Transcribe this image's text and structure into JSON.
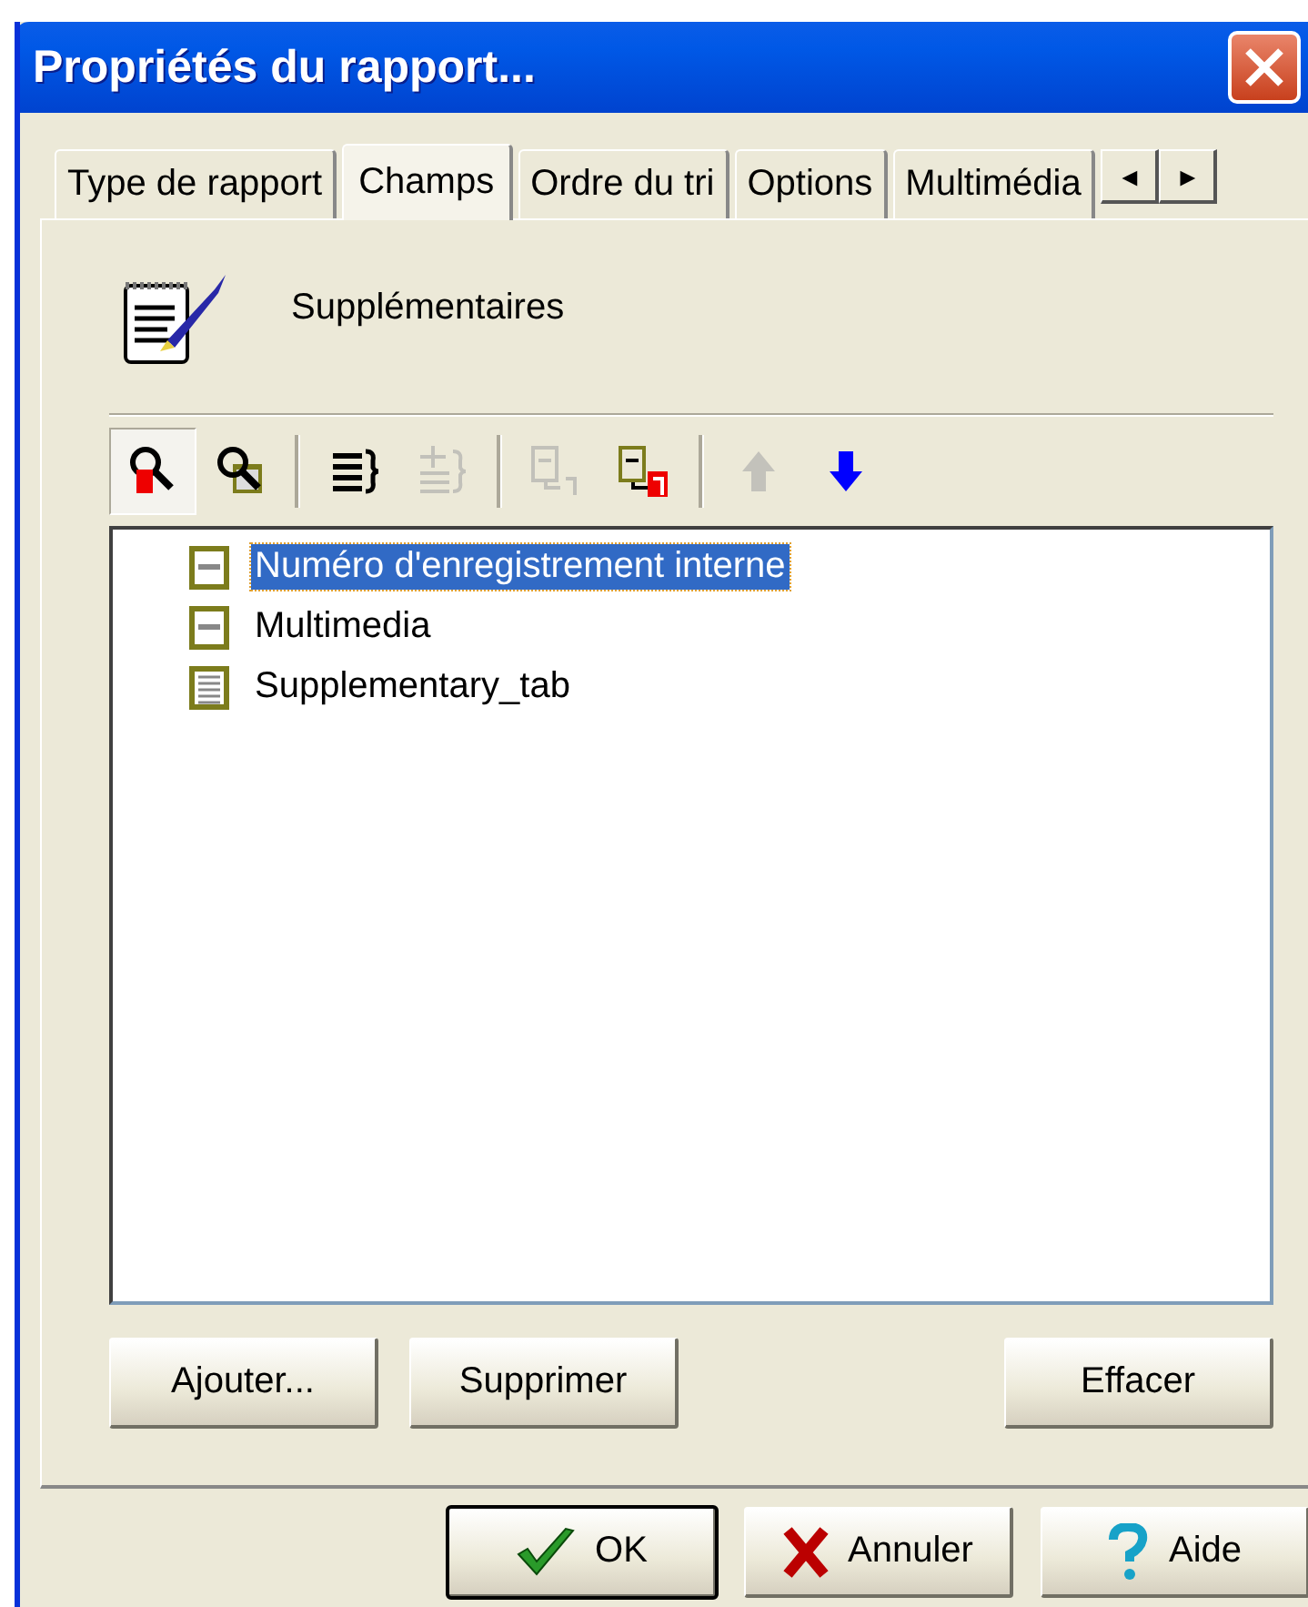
{
  "window": {
    "title": "Propriétés du rapport..."
  },
  "tabs": [
    {
      "label": "Type de rapport",
      "selected": false
    },
    {
      "label": "Champs",
      "selected": true
    },
    {
      "label": "Ordre du tri",
      "selected": false
    },
    {
      "label": "Options",
      "selected": false
    },
    {
      "label": "Multimédia",
      "selected": false
    }
  ],
  "tab_scroll": [
    "◄",
    "►"
  ],
  "header": {
    "label": "Supplémentaires"
  },
  "toolbar": [
    {
      "kind": "search-field",
      "selected": true,
      "disabled": false
    },
    {
      "kind": "search-table",
      "selected": false,
      "disabled": false
    },
    {
      "kind": "sep"
    },
    {
      "kind": "collapse",
      "selected": false,
      "disabled": false
    },
    {
      "kind": "expand",
      "selected": false,
      "disabled": true
    },
    {
      "kind": "sep"
    },
    {
      "kind": "rename",
      "selected": false,
      "disabled": true
    },
    {
      "kind": "rename",
      "selected": false,
      "disabled": false
    },
    {
      "kind": "sep"
    },
    {
      "kind": "up",
      "selected": false,
      "disabled": true
    },
    {
      "kind": "down",
      "selected": false,
      "disabled": false
    }
  ],
  "tree": [
    {
      "kind": "field",
      "label": "Numéro d'enregistrement interne",
      "selected": true
    },
    {
      "kind": "field",
      "label": "Multimedia",
      "selected": false
    },
    {
      "kind": "table",
      "label": "Supplementary_tab",
      "selected": false
    }
  ],
  "panel_buttons_left": [
    "Ajouter...",
    "Supprimer"
  ],
  "panel_buttons_right": [
    "Effacer"
  ],
  "dialog_buttons": [
    {
      "kind": "ok",
      "label": "OK",
      "default": true
    },
    {
      "kind": "cancel",
      "label": "Annuler",
      "default": false
    },
    {
      "kind": "help",
      "label": "Aide",
      "default": false
    }
  ]
}
